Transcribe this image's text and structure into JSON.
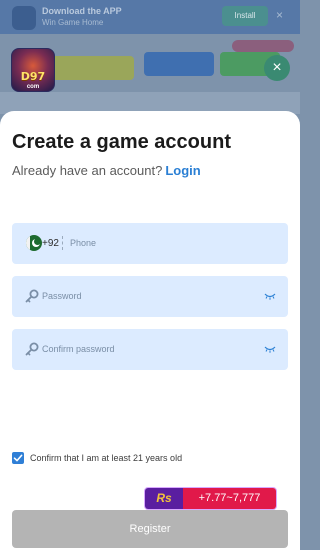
{
  "background": {
    "title": "Download the APP",
    "subtitle": "Win Game Home",
    "button": "Install"
  },
  "logo": {
    "text": "D97",
    "sub": "com"
  },
  "modal": {
    "title": "Create a game account",
    "subtitle": "Already have an account?",
    "login_link": "Login"
  },
  "form": {
    "country_code": "+92",
    "phone_placeholder": "Phone",
    "password_placeholder": "Password",
    "confirm_placeholder": "Confirm password",
    "age_confirm_label": "Confirm that I am at least 21 years old",
    "age_confirm_checked": true,
    "register_label": "Register"
  },
  "promo": {
    "currency": "Rs",
    "value": "+7.77~7,777"
  },
  "colors": {
    "accent": "#2a7fd4",
    "field_bg": "#dcebff",
    "register_disabled": "#b4b4b4",
    "promo_purple": "#5a1ea0",
    "promo_red": "#e1194a"
  },
  "icons": [
    "close-icon",
    "flag-pakistan-icon",
    "key-icon",
    "eye-closed-icon",
    "checkmark-icon"
  ]
}
